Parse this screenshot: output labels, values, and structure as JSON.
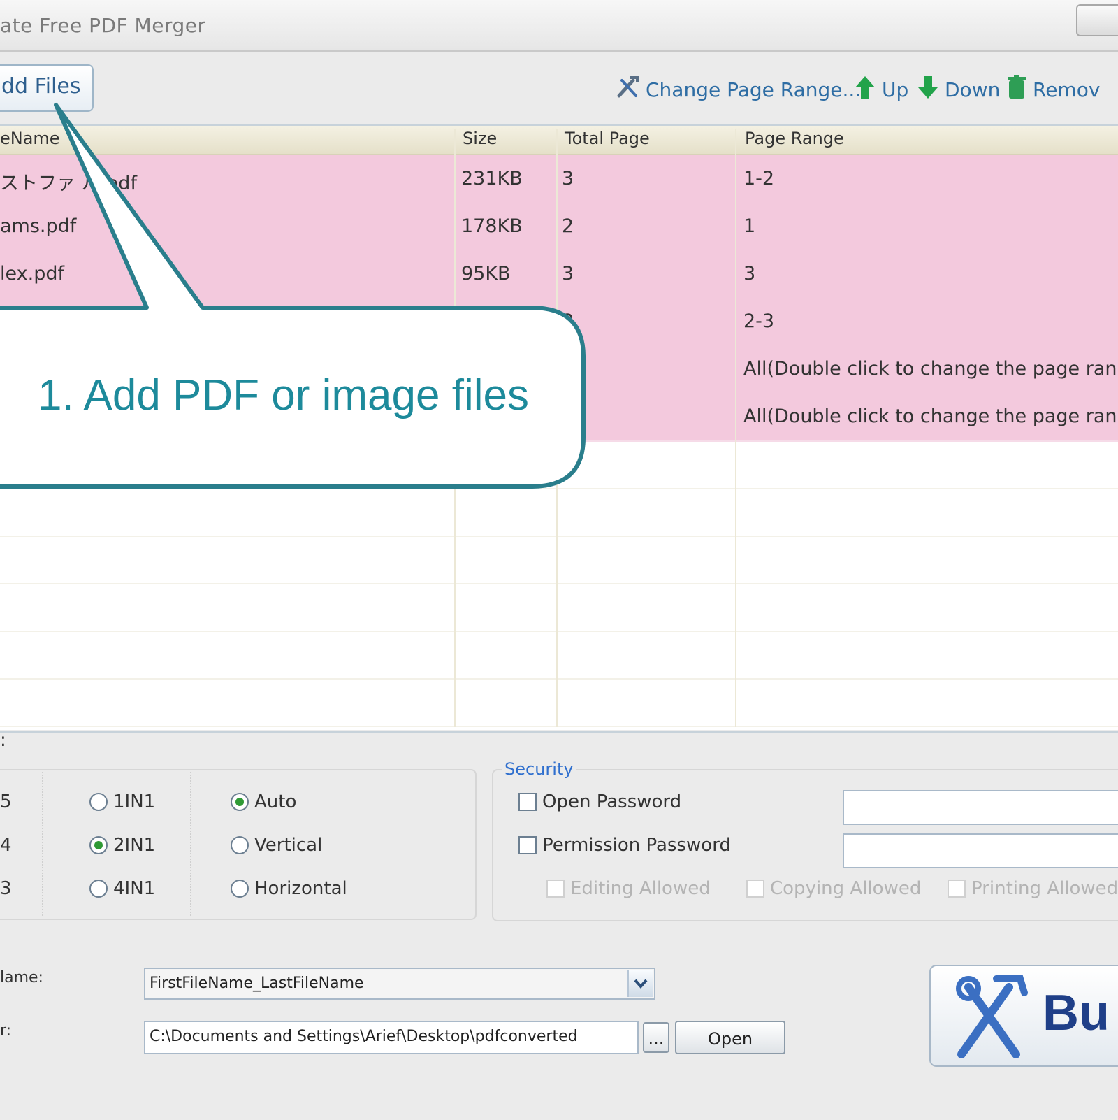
{
  "window": {
    "title": "ate Free PDF Merger"
  },
  "toolbar": {
    "add_files_label": "dd Files",
    "change_page_range_label": "Change Page Range...",
    "up_label": "Up",
    "down_label": "Down",
    "remove_label": "Remov"
  },
  "file_table": {
    "columns": [
      "eName",
      "Size",
      "Total Page",
      "Page Range"
    ],
    "rows": [
      {
        "name": "ストファ  ル.pdf",
        "size": "231KB",
        "total_page": "3",
        "page_range": "1-2"
      },
      {
        "name": "ams.pdf",
        "size": "178KB",
        "total_page": "2",
        "page_range": "1"
      },
      {
        "name": "lex.pdf",
        "size": "95KB",
        "total_page": "3",
        "page_range": "3"
      },
      {
        "name": "",
        "size": "",
        "total_page": "3",
        "page_range": "2-3"
      },
      {
        "name": "",
        "size": "",
        "total_page": "",
        "page_range": "All(Double click to change the page range"
      },
      {
        "name": "",
        "size": "",
        "total_page": "",
        "page_range": "All(Double click to change the page range"
      }
    ]
  },
  "callout": {
    "text": "1. Add PDF or image files"
  },
  "options": {
    "cut_label_1": ":",
    "left_numbers": [
      "5",
      "4",
      "3"
    ],
    "pages_per_sheet": [
      {
        "label": "1IN1",
        "selected": false
      },
      {
        "label": "2IN1",
        "selected": true
      },
      {
        "label": "4IN1",
        "selected": false
      }
    ],
    "orientation": [
      {
        "label": "Auto",
        "selected": true
      },
      {
        "label": "Vertical",
        "selected": false
      },
      {
        "label": "Horizontal",
        "selected": false
      }
    ]
  },
  "security": {
    "title": "Security",
    "open_password_label": "Open Password",
    "permission_password_label": "Permission Password",
    "open_password_value": "",
    "permission_password_value": "",
    "editing_allowed_label": "Editing Allowed",
    "copying_allowed_label": "Copying Allowed",
    "printing_allowed_label": "Printing Allowed"
  },
  "output": {
    "name_label": "lame:",
    "folder_label": "r:",
    "name_value": "FirstFileName_LastFileName",
    "folder_value": "C:\\Documents and Settings\\Arief\\Desktop\\pdfconverted",
    "browse_label": "...",
    "open_label": "Open",
    "build_label": "Bu"
  },
  "colors": {
    "accent_blue": "#2e6da4",
    "row_pink": "#f3c9dd",
    "callout_teal": "#1d8a9b",
    "radio_green": "#2f9a35"
  }
}
